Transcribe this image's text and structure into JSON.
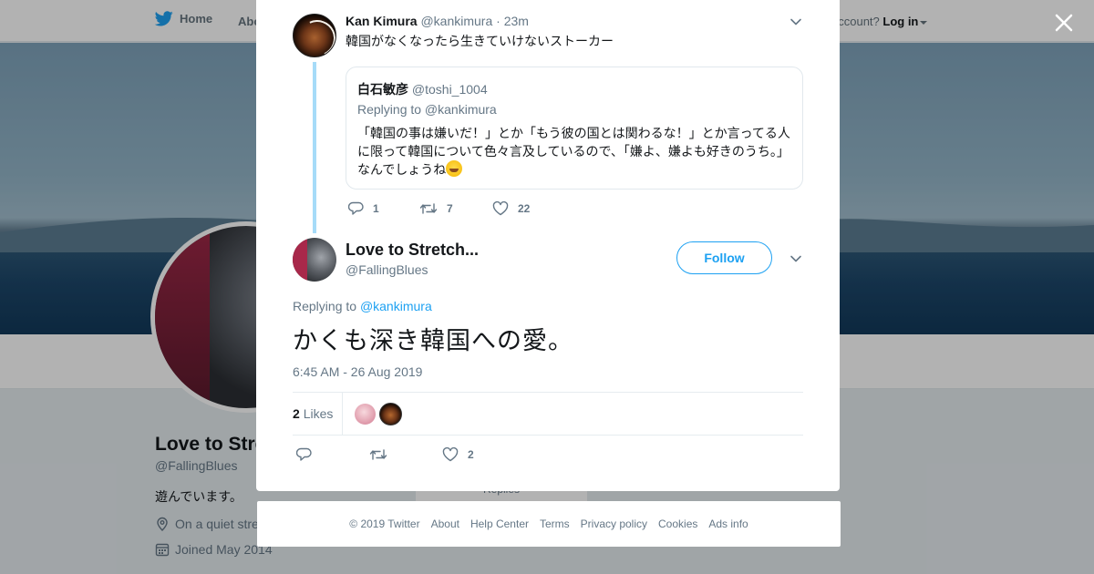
{
  "topbar": {
    "home_label": "Home",
    "about_label": "Abo",
    "account_prompt": "account?",
    "login_label": "Log in"
  },
  "profile": {
    "name": "Love to Stre",
    "handle": "@FallingBlues",
    "bio": "遊んでいます。",
    "location": "On a quiet stre",
    "joined": "Joined May 2014",
    "tab_fragment": "Replies"
  },
  "parent_tweet": {
    "name": "Kan Kimura",
    "handle": "@kankimura",
    "time": "· 23m",
    "text": "韓国がなくなったら生きていけないストーカー",
    "quote": {
      "name": "白石敏彦",
      "handle": "@toshi_1004",
      "replying": "Replying to @kankimura",
      "body": "「韓国の事は嫌いだ！」とか「もう彼の国とは関わるな！」とか言ってる人に限って韓国について色々言及しているので、「嫌よ、嫌よも好きのうち。」なんでしょうね"
    },
    "replies": "1",
    "retweets": "7",
    "likes": "22"
  },
  "reply_tweet": {
    "name": "Love to Stretch...",
    "handle": "@FallingBlues",
    "follow_label": "Follow",
    "replying_prefix": "Replying to",
    "replying_handle": "@kankimura",
    "text": "かくも深き韓国への愛。",
    "timestamp": "6:45 AM - 26 Aug 2019",
    "likes_count": "2",
    "likes_label": "Likes",
    "action_likes": "2"
  },
  "footer": {
    "copyright": "© 2019 Twitter",
    "about": "About",
    "help": "Help Center",
    "terms": "Terms",
    "privacy": "Privacy policy",
    "cookies": "Cookies",
    "ads": "Ads info"
  },
  "colors": {
    "accent": "#1da1f2",
    "thread_line": "#a6dbf8",
    "muted_text": "#657786"
  }
}
